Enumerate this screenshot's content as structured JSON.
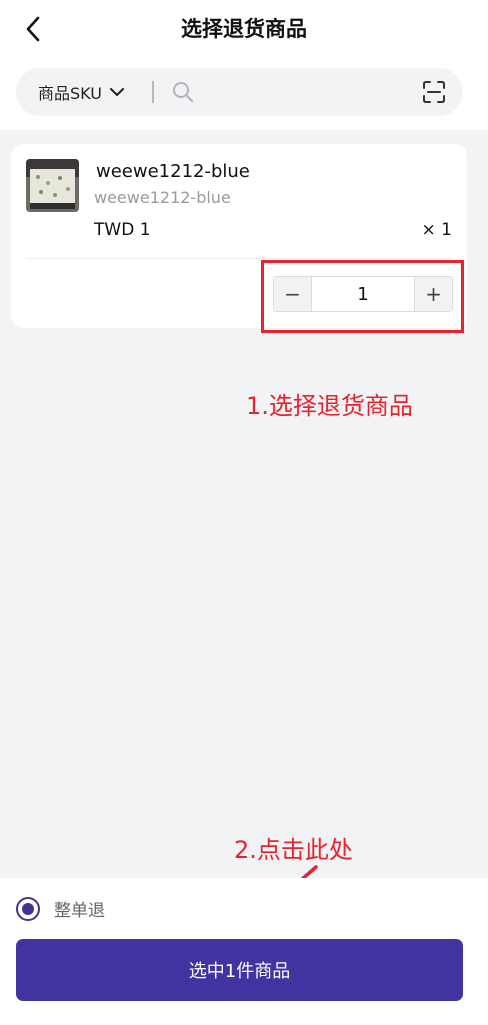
{
  "header": {
    "title": "选择退货商品",
    "back_icon": "chevron-left-icon"
  },
  "search": {
    "filter_label": "商品SKU",
    "placeholder": "",
    "search_icon": "search-icon",
    "scan_icon": "scan-icon"
  },
  "product": {
    "name": "weewe1212-blue",
    "sku": "weewe1212-blue",
    "price": "TWD 1",
    "quantity_label": "× 1",
    "stepper": {
      "minus": "−",
      "value": "1",
      "plus": "+"
    }
  },
  "annotations": {
    "step1": "1.选择退货商品",
    "step2": "2.点击此处",
    "color": "#e8222e"
  },
  "footer": {
    "radio_label": "整单退",
    "radio_checked": true,
    "confirm_label": "选中1件商品"
  },
  "colors": {
    "accent": "#4134a0",
    "background": "#f2f3f5"
  }
}
